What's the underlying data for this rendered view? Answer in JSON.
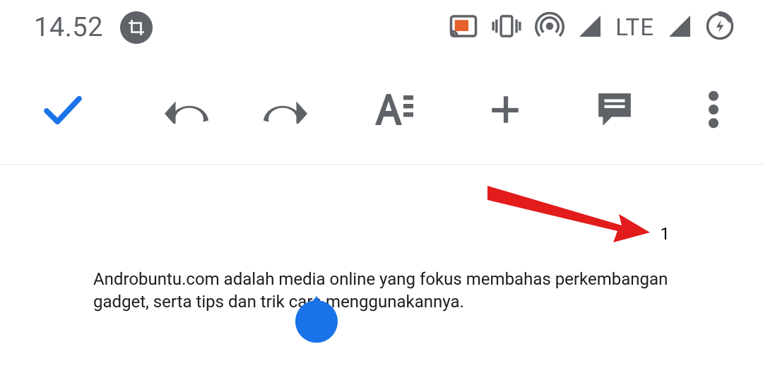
{
  "status_bar": {
    "time": "14.52",
    "network_label": "LTE"
  },
  "document": {
    "page_number": "1",
    "body_text": "Androbuntu.com adalah media online yang fokus membahas perkembangan gadget, serta tips dan trik cara menggunakannya."
  }
}
